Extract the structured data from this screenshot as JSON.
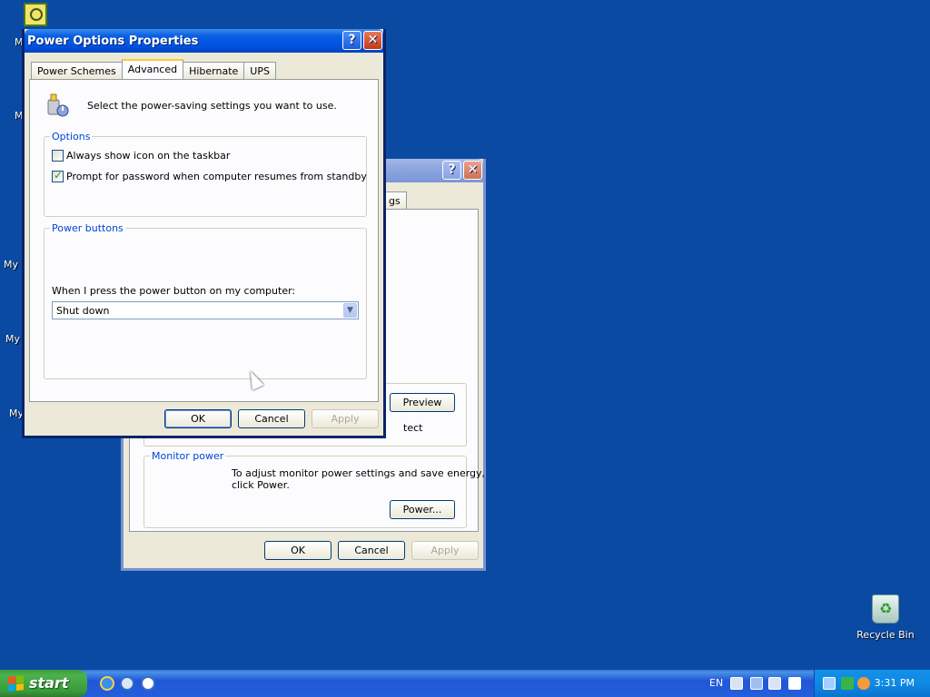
{
  "desktop": {
    "partial_labels": [
      "M",
      "M",
      "My I",
      "My",
      "My"
    ],
    "recycle_bin_label": "Recycle Bin"
  },
  "back_window": {
    "tab_partial": "gs",
    "preview_button": "Preview",
    "partial_text": "tect",
    "monitor_power_title": "Monitor power",
    "monitor_power_text_line1": "To adjust monitor power settings and save energy,",
    "monitor_power_text_line2": "click Power.",
    "power_button": "Power...",
    "ok_button": "OK",
    "cancel_button": "Cancel",
    "apply_button": "Apply"
  },
  "dialog": {
    "title": "Power Options Properties",
    "help_button": "?",
    "close_button": "✕",
    "tabs": [
      {
        "label": "Power Schemes",
        "active": false
      },
      {
        "label": "Advanced",
        "active": true
      },
      {
        "label": "Hibernate",
        "active": false
      },
      {
        "label": "UPS",
        "active": false
      }
    ],
    "intro_text": "Select the power-saving settings you want to use.",
    "options_group_title": "Options",
    "option_show_icon": {
      "label": "Always show icon on the taskbar",
      "checked": false
    },
    "option_prompt_password": {
      "label": "Prompt for password when computer resumes from standby",
      "checked": true
    },
    "power_buttons_group_title": "Power buttons",
    "power_button_label": "When I press the power button on my computer:",
    "power_button_value": "Shut down",
    "ok_button": "OK",
    "cancel_button": "Cancel",
    "apply_button": "Apply"
  },
  "taskbar": {
    "start_label": "start",
    "language": "EN",
    "clock": "3:31 PM"
  },
  "colors": {
    "desktop": "#0b4aa2",
    "titlebar_active": "#0054e3",
    "group_title": "#0046d5",
    "dialog_face": "#ece9d8"
  }
}
